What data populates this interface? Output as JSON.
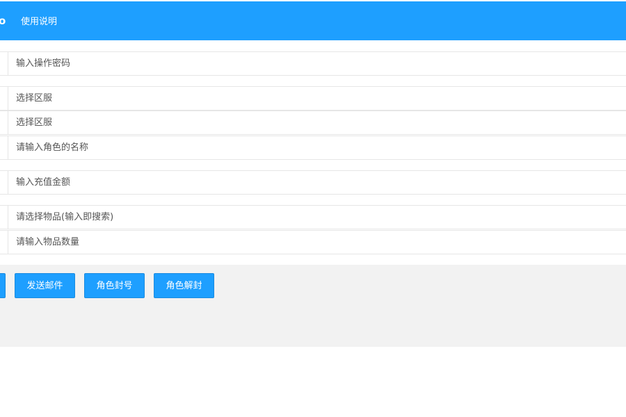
{
  "header": {
    "logo_fragment": "o",
    "help_link": "使用说明"
  },
  "form": {
    "password_placeholder": "输入操作密码",
    "server1_placeholder": "选择区服",
    "server2_placeholder": "选择区服",
    "role_name_placeholder": "请输入角色的名称",
    "recharge_placeholder": "输入充值金额",
    "item_placeholder": "请选择物品(输入即搜索)",
    "item_qty_placeholder": "请输入物品数量"
  },
  "actions": {
    "send_mail": "发送邮件",
    "ban_role": "角色封号",
    "unban_role": "角色解封"
  },
  "colors": {
    "primary": "#1e9fff",
    "panel_bg": "#f2f2f2",
    "border": "#e6e6e6"
  }
}
